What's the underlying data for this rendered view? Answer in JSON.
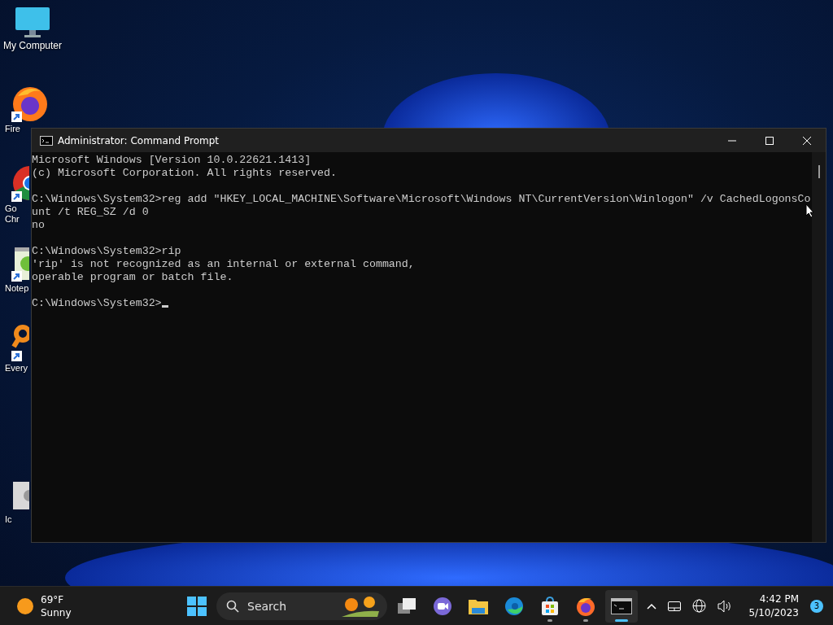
{
  "desktop_icons": [
    {
      "kind": "computer",
      "label": "My Computer"
    },
    {
      "kind": "firefox",
      "label": "Fire",
      "shortcut": true
    },
    {
      "kind": "chrome",
      "label": "Go\nChr",
      "shortcut": true
    },
    {
      "kind": "notepad",
      "label": "Notep",
      "shortcut": true
    },
    {
      "kind": "search",
      "label": "Every",
      "shortcut": true
    },
    {
      "kind": "generic",
      "label": "Ic"
    }
  ],
  "window": {
    "title": "Administrator: Command Prompt",
    "console_blocks": [
      [
        "Microsoft Windows [Version 10.0.22621.1413]",
        "(c) Microsoft Corporation. All rights reserved."
      ],
      [
        "C:\\Windows\\System32>reg add \"HKEY_LOCAL_MACHINE\\Software\\Microsoft\\Windows NT\\CurrentVersion\\Winlogon\" /v CachedLogonsCo",
        "unt /t REG_SZ /d 0",
        "no"
      ],
      [
        "C:\\Windows\\System32>rip",
        "'rip' is not recognized as an internal or external command,",
        "operable program or batch file."
      ],
      [
        "C:\\Windows\\System32>"
      ]
    ]
  },
  "taskbar": {
    "weather": {
      "temperature": "69°F",
      "condition": "Sunny"
    },
    "search": {
      "placeholder": "Search"
    },
    "apps": [
      {
        "kind": "start",
        "running": false,
        "active": false
      },
      {
        "kind": "taskview",
        "running": false,
        "active": false
      },
      {
        "kind": "chat",
        "running": false,
        "active": false
      },
      {
        "kind": "explorer",
        "running": false,
        "active": false
      },
      {
        "kind": "edge",
        "running": false,
        "active": false
      },
      {
        "kind": "store",
        "running": true,
        "active": false
      },
      {
        "kind": "firefox",
        "running": true,
        "active": false
      },
      {
        "kind": "terminal",
        "running": true,
        "active": true
      }
    ],
    "time": "4:42 PM",
    "date": "5/10/2023",
    "notification_count": "3"
  }
}
